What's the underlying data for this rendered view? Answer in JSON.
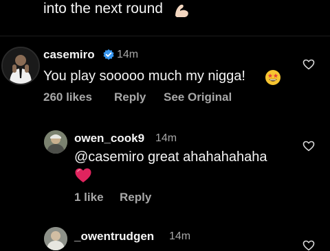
{
  "previous_comment": {
    "text_tail": "into the next round",
    "emoji": "flexed-biceps-icon"
  },
  "comments": [
    {
      "username": "casemiro",
      "verified": true,
      "time": "14m",
      "text": "You play sooooo much my nigga!",
      "emoji": "star-struck-icon",
      "likes": "260 likes",
      "reply": "Reply",
      "see_original": "See Original"
    },
    {
      "username": "owen_cook9",
      "time": "14m",
      "text": "@casemiro great ahahahahaha",
      "emoji": "red-heart-icon",
      "likes": "1 like",
      "reply": "Reply"
    },
    {
      "username": "_owentrudgen",
      "time": "14m"
    }
  ],
  "colors": {
    "background": "#000000",
    "text": "#f5f5f5",
    "muted": "#a8a8a8",
    "verified": "#3897f0",
    "heart": "#e0245e"
  }
}
